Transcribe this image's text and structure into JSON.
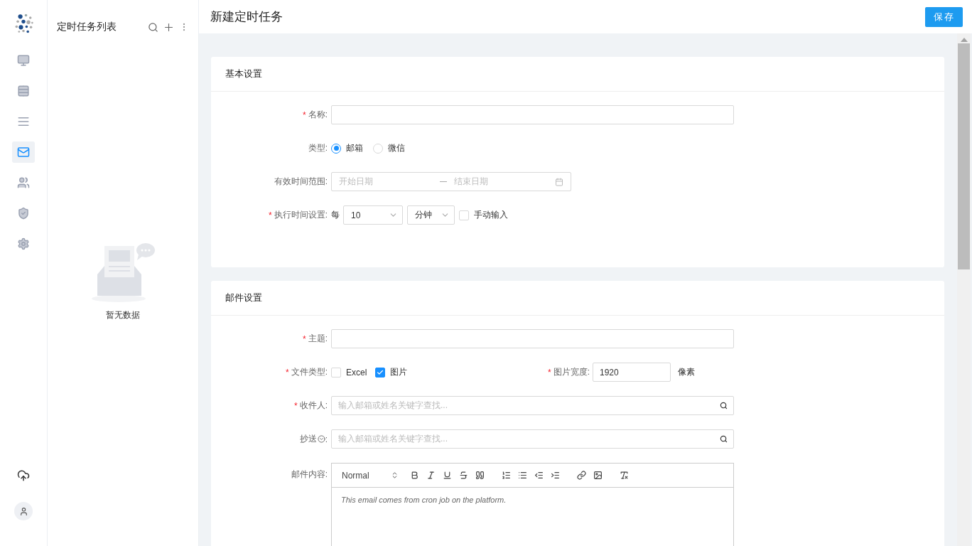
{
  "nav_items": [
    {
      "kind": "dashboard",
      "selected": false
    },
    {
      "kind": "table",
      "selected": false
    },
    {
      "kind": "rows",
      "selected": false
    },
    {
      "kind": "mail",
      "selected": true
    },
    {
      "kind": "users",
      "selected": false
    },
    {
      "kind": "shield",
      "selected": false
    },
    {
      "kind": "settings",
      "selected": false
    }
  ],
  "nav_bottom": [
    {
      "kind": "upload"
    },
    {
      "kind": "user"
    }
  ],
  "list_panel": {
    "title": "定时任务列表",
    "empty_text": "暂无数据"
  },
  "header": {
    "title": "新建定时任务",
    "save_button": "保存"
  },
  "sections": [
    {
      "title": "基本设置",
      "fields": [
        {
          "kind": "text",
          "label": "名称:",
          "mark": "*"
        },
        {
          "kind": "radio",
          "label": "类型:",
          "options": [
            {
              "label": "邮箱",
              "selected": true
            },
            {
              "label": "微信",
              "selected": false
            }
          ]
        },
        {
          "kind": "daterange",
          "label": "有效时间范围:",
          "start_placeholder": "开始日期",
          "end_placeholder": "结束日期"
        },
        {
          "kind": "schedule",
          "label": "执行时间设置:",
          "mark": "*",
          "prefix": "每",
          "interval": "10",
          "unit": "分钟",
          "manual": {
            "label": "手动输入",
            "checked": false
          }
        }
      ]
    },
    {
      "title": "邮件设置",
      "fields": [
        {
          "kind": "text",
          "label": "主题:",
          "mark": "*"
        },
        {
          "kind": "filetype",
          "label": "文件类型:",
          "mark": "*",
          "options": [
            {
              "label": "Excel",
              "checked": false
            },
            {
              "label": "图片",
              "checked": true
            }
          ],
          "width": {
            "label": "图片宽度:",
            "mark": "*",
            "value": "1920",
            "unit": "像素"
          }
        },
        {
          "kind": "search",
          "label": "收件人:",
          "mark": "*",
          "placeholder": "输入邮箱或姓名关键字查找..."
        },
        {
          "kind": "search",
          "label": "抄送",
          "colon": ":",
          "help": true,
          "placeholder": "输入邮箱或姓名关键字查找..."
        },
        {
          "kind": "editor",
          "label": "邮件内容:",
          "format": "Normal",
          "content": "This email comes from cron job on the platform."
        }
      ]
    }
  ]
}
